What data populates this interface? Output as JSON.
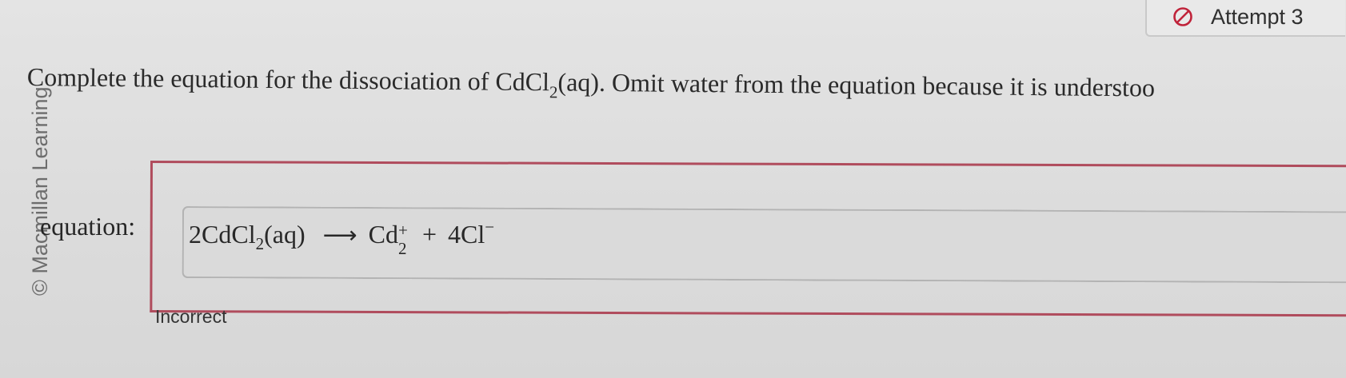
{
  "attempt": {
    "label": "Attempt 3",
    "icon": "no-entry-icon",
    "color": "#c0233a"
  },
  "watermark": "© Macmillan Learning",
  "question": {
    "before": "Complete the equation for the dissociation of CdCl",
    "sub": "2",
    "after": "(aq). Omit water from the equation because it is understoo"
  },
  "equation": {
    "label": "equation:",
    "reactant_coef_formula": "2CdCl",
    "reactant_sub": "2",
    "reactant_state": "(aq)",
    "arrow": "⟶",
    "product1_symbol": "Cd",
    "product1_sup": "+",
    "product1_sub": "2",
    "plus": "+",
    "product2": "4Cl",
    "product2_sup": "−"
  },
  "feedback": {
    "text": "Incorrect",
    "frame_color": "#b04c5d"
  }
}
